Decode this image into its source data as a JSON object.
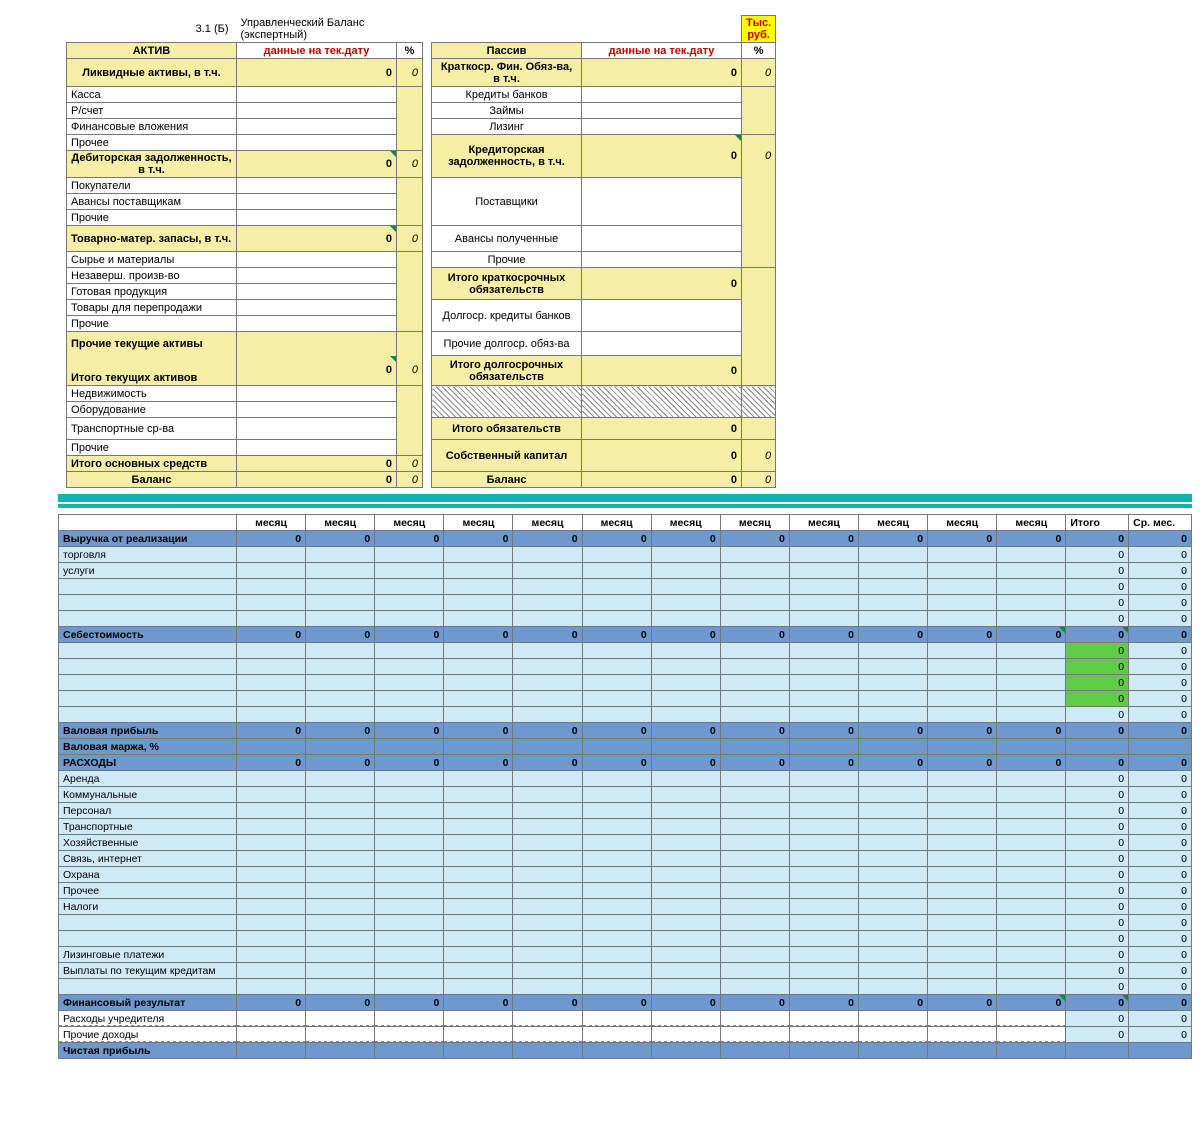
{
  "title": {
    "code": "3.1 (Б)",
    "text": "Управленческий Баланс (экспертный)",
    "unit": "Тыс. руб."
  },
  "heads": {
    "aktiv": "АКТИВ",
    "passiv": "Пассив",
    "asof": "данные на тек.дату",
    "pct": "%"
  },
  "left": {
    "liquid": {
      "lbl": "Ликвидные активы, в т.ч.",
      "v": "0",
      "p": "0"
    },
    "kassa": "Касса",
    "rschet": "Р/счет",
    "finvl": "Финансовые вложения",
    "pro1": "Прочее",
    "deb": {
      "lbl": "Дебиторская задолженность, в т.ч.",
      "v": "0",
      "p": "0"
    },
    "pok": "Покупатели",
    "avpost": "Авансы поставщикам",
    "pro2": "Прочие",
    "tmz": {
      "lbl": "Товарно-матер. запасы, в т.ч.",
      "v": "0",
      "p": "0"
    },
    "syr": "Сырье и материалы",
    "nezav": "Незаверш. произв-во",
    "gp": "Готовая продукция",
    "tpp": "Товары для перепродажи",
    "pro3": "Прочие",
    "pta": "Прочие текущие активы",
    "ita": {
      "lbl": "Итого текущих активов",
      "v": "0",
      "p": "0"
    },
    "nedv": "Недвижимость",
    "obor": "Оборудование",
    "trsr": "Транспортные ср-ва",
    "pro4": "Прочие",
    "ios": {
      "lbl": "Итого основных средств",
      "v": "0",
      "p": "0"
    },
    "bal": {
      "lbl": "Баланс",
      "v": "0",
      "p": "0"
    }
  },
  "right": {
    "kfo": {
      "lbl": "Краткоср. Фин. Обяз-ва, в т.ч.",
      "v": "0",
      "p": "0"
    },
    "kb": "Кредиты банков",
    "zaim": "Займы",
    "liz": "Лизинг",
    "kz": {
      "lbl": "Кредиторская задолженность, в т.ч.",
      "v": "0",
      "p": "0"
    },
    "post": "Поставщики",
    "avpol": "Авансы полученные",
    "pro": "Прочие",
    "iko": {
      "lbl": "Итого краткосрочных обязательств",
      "v": "0"
    },
    "dkb": "Долгоср. кредиты банков",
    "pdo": "Прочие долгоср. обяз-ва",
    "ido": {
      "lbl": "Итого долгосрочных обязательств",
      "v": "0"
    },
    "iobz": {
      "lbl": "Итого обязательств",
      "v": "0"
    },
    "sk": {
      "lbl": "Собственный капитал",
      "v": "0",
      "p": "0"
    },
    "bal": {
      "lbl": "Баланс",
      "v": "0",
      "p": "0"
    }
  },
  "pl": {
    "months": [
      "месяц",
      "месяц",
      "месяц",
      "месяц",
      "месяц",
      "месяц",
      "месяц",
      "месяц",
      "месяц",
      "месяц",
      "месяц",
      "месяц"
    ],
    "itogo": "Итого",
    "sr": "Ср. мес.",
    "z": "0",
    "rows": {
      "rev": "Выручка от реализации",
      "torg": "торговля",
      "usl": "услуги",
      "seb": "Себестоимость",
      "vp": "Валовая прибыль",
      "vm": "Валовая маржа, %",
      "ras": "РАСХОДЫ",
      "ar": "Аренда",
      "kom": "Коммунальные",
      "per": "Персонал",
      "tr": "Транспортные",
      "hoz": "Хозяйственные",
      "sv": "Связь, интернет",
      "ohr": "Охрана",
      "proc": "Прочее",
      "nal": "Налоги",
      "lizp": "Лизинговые платежи",
      "vtk": "Выплаты по текущим кредитам",
      "fr": "Финансовый результат",
      "ruch": "Расходы учредителя",
      "prd": "Прочие доходы",
      "np": "Чистая прибыль"
    }
  }
}
